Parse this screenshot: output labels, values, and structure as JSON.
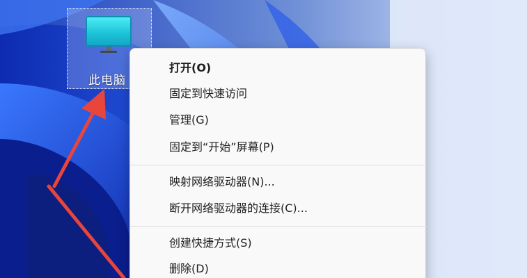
{
  "desktop": {
    "icon": {
      "label": "此电脑",
      "icon_name": "this-pc-monitor-icon"
    }
  },
  "context_menu": {
    "items": [
      {
        "label": "打开(O)",
        "bold": true
      },
      {
        "label": "固定到快速访问"
      },
      {
        "label": "管理(G)"
      },
      {
        "label": "固定到“开始”屏幕(P)"
      },
      {
        "label": "映射网络驱动器(N)..."
      },
      {
        "label": "断开网络驱动器的连接(C)..."
      },
      {
        "label": "创建快捷方式(S)"
      },
      {
        "label": "删除(D)"
      }
    ]
  },
  "annotation": {
    "arrow_color": "#e8453c",
    "arrow_icon": "red-arrow-icon"
  },
  "colors": {
    "wallpaper_dark": "#0a2aa8",
    "wallpaper_mid": "#2f6cf0",
    "wallpaper_light": "#d8e6fb",
    "menu_bg": "#f9f9f9"
  }
}
